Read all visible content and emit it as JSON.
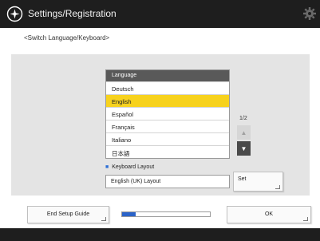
{
  "header": {
    "title": "Settings/Registration",
    "icon": "settings-registration-icon",
    "right_icon": "gear-icon"
  },
  "breadcrumb": "<Switch Language/Keyboard>",
  "language_list": {
    "header": "Language",
    "items": [
      "Deutsch",
      "English",
      "Español",
      "Français",
      "Italiano",
      "日本語"
    ],
    "selected": "English"
  },
  "pagination": {
    "indicator": "1/2",
    "up_icon": "triangle-up-icon",
    "down_icon": "triangle-down-icon"
  },
  "keyboard": {
    "label": "Keyboard Layout",
    "value": "English (UK) Layout",
    "set_label": "Set"
  },
  "footer": {
    "end_setup_label": "End Setup Guide",
    "ok_label": "OK",
    "progress": 0.15
  },
  "colors": {
    "header_bg": "#1e1e1e",
    "selected_row": "#f7d21d",
    "progress_fill": "#2b63c8",
    "panel_bg": "#e4e4e4"
  }
}
